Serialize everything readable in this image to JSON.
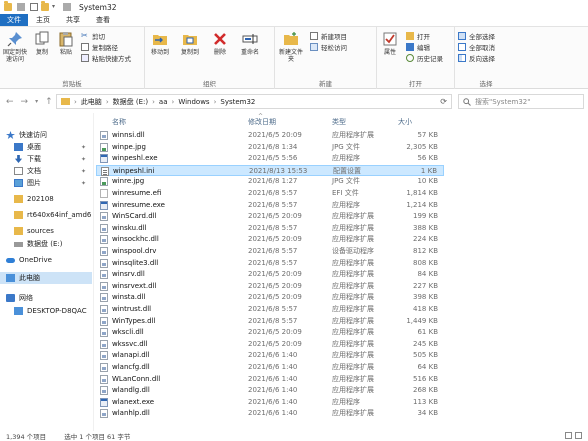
{
  "window": {
    "title": "System32"
  },
  "tabs": [
    "文件",
    "主页",
    "共享",
    "查看"
  ],
  "ribbon": {
    "clipboard": {
      "pin_label": "固定到快速访问",
      "copy_label": "复制",
      "paste_label": "粘贴",
      "cut_label": "剪切",
      "copy_path_label": "复制路径",
      "paste_shortcut_label": "粘贴快捷方式",
      "group_label": "剪贴板"
    },
    "organize": {
      "move_label": "移动到",
      "copy_to_label": "复制到",
      "delete_label": "删除",
      "rename_label": "重命名",
      "group_label": "组织"
    },
    "new": {
      "new_folder_label": "新建文件夹",
      "new_item_label": "新建项目",
      "easy_access_label": "轻松访问",
      "group_label": "新建"
    },
    "open": {
      "properties_label": "属性",
      "open_label": "打开",
      "edit_label": "编辑",
      "history_label": "历史记录",
      "group_label": "打开"
    },
    "select": {
      "select_all_label": "全部选择",
      "select_none_label": "全部取消",
      "invert_label": "反向选择",
      "group_label": "选择"
    }
  },
  "address": {
    "crumbs": [
      "此电脑",
      "数据盘 (E:)",
      "aa",
      "Windows",
      "System32"
    ],
    "search_placeholder": "搜索\"System32\""
  },
  "navpane": [
    {
      "label": "快速访问",
      "icon": "star-icon",
      "pinned": false
    },
    {
      "label": "桌面",
      "icon": "desktop-icon",
      "pinned": true
    },
    {
      "label": "下载",
      "icon": "download-icon",
      "pinned": true
    },
    {
      "label": "文档",
      "icon": "document-icon",
      "pinned": true
    },
    {
      "label": "图片",
      "icon": "picture-icon",
      "pinned": true
    },
    {
      "label": "202108",
      "icon": "folder-icon",
      "pinned": false
    },
    {
      "label": "rt640x64inf_amd6",
      "icon": "folder-icon",
      "pinned": false
    },
    {
      "label": "sources",
      "icon": "folder-icon",
      "pinned": false
    },
    {
      "label": "数据盘 (E:)",
      "icon": "drive-icon",
      "pinned": false
    },
    {
      "label": "OneDrive",
      "icon": "cloud-icon",
      "pinned": false
    },
    {
      "label": "此电脑",
      "icon": "computer-icon",
      "pinned": false
    },
    {
      "label": "网络",
      "icon": "network-icon",
      "pinned": false
    },
    {
      "label": "DESKTOP-D8QAC",
      "icon": "computer-icon",
      "pinned": false
    }
  ],
  "columns": {
    "name": "名称",
    "date": "修改日期",
    "type": "类型",
    "size": "大小"
  },
  "files": [
    {
      "name": "winnsi.dll",
      "date": "2021/6/5 20:09",
      "type": "应用程序扩展",
      "size": "57 KB",
      "kind": "dll"
    },
    {
      "name": "winpe.jpg",
      "date": "2021/6/8 1:34",
      "type": "JPG 文件",
      "size": "2,305 KB",
      "kind": "img"
    },
    {
      "name": "winpeshl.exe",
      "date": "2021/6/5 5:56",
      "type": "应用程序",
      "size": "56 KB",
      "kind": "exe"
    },
    {
      "name": "winpeshl.ini",
      "date": "2021/8/13 15:53",
      "type": "配置设置",
      "size": "1 KB",
      "kind": "ini"
    },
    {
      "name": "winre.jpg",
      "date": "2021/6/8 1:27",
      "type": "JPG 文件",
      "size": "10 KB",
      "kind": "img"
    },
    {
      "name": "winresume.efi",
      "date": "2021/6/8 5:57",
      "type": "EFI 文件",
      "size": "1,814 KB",
      "kind": "efi"
    },
    {
      "name": "winresume.exe",
      "date": "2021/6/8 5:57",
      "type": "应用程序",
      "size": "1,214 KB",
      "kind": "exe"
    },
    {
      "name": "WinSCard.dll",
      "date": "2021/6/5 20:09",
      "type": "应用程序扩展",
      "size": "199 KB",
      "kind": "dll"
    },
    {
      "name": "winsku.dll",
      "date": "2021/6/8 5:57",
      "type": "应用程序扩展",
      "size": "388 KB",
      "kind": "dll"
    },
    {
      "name": "winsockhc.dll",
      "date": "2021/6/5 20:09",
      "type": "应用程序扩展",
      "size": "224 KB",
      "kind": "dll"
    },
    {
      "name": "winspool.drv",
      "date": "2021/6/8 5:57",
      "type": "设备驱动程序",
      "size": "812 KB",
      "kind": "dll"
    },
    {
      "name": "winsqlite3.dll",
      "date": "2021/6/8 5:57",
      "type": "应用程序扩展",
      "size": "808 KB",
      "kind": "dll"
    },
    {
      "name": "winsrv.dll",
      "date": "2021/6/5 20:09",
      "type": "应用程序扩展",
      "size": "84 KB",
      "kind": "dll"
    },
    {
      "name": "winsrvext.dll",
      "date": "2021/6/5 20:09",
      "type": "应用程序扩展",
      "size": "227 KB",
      "kind": "dll"
    },
    {
      "name": "winsta.dll",
      "date": "2021/6/5 20:09",
      "type": "应用程序扩展",
      "size": "398 KB",
      "kind": "dll"
    },
    {
      "name": "wintrust.dll",
      "date": "2021/6/8 5:57",
      "type": "应用程序扩展",
      "size": "418 KB",
      "kind": "dll"
    },
    {
      "name": "WinTypes.dll",
      "date": "2021/6/8 5:57",
      "type": "应用程序扩展",
      "size": "1,449 KB",
      "kind": "dll"
    },
    {
      "name": "wkscli.dll",
      "date": "2021/6/5 20:09",
      "type": "应用程序扩展",
      "size": "61 KB",
      "kind": "dll"
    },
    {
      "name": "wkssvc.dll",
      "date": "2021/6/5 20:09",
      "type": "应用程序扩展",
      "size": "245 KB",
      "kind": "dll"
    },
    {
      "name": "wlanapi.dll",
      "date": "2021/6/6 1:40",
      "type": "应用程序扩展",
      "size": "505 KB",
      "kind": "dll"
    },
    {
      "name": "wlancfg.dll",
      "date": "2021/6/6 1:40",
      "type": "应用程序扩展",
      "size": "64 KB",
      "kind": "dll"
    },
    {
      "name": "WLanConn.dll",
      "date": "2021/6/6 1:40",
      "type": "应用程序扩展",
      "size": "516 KB",
      "kind": "dll"
    },
    {
      "name": "wlandlg.dll",
      "date": "2021/6/6 1:40",
      "type": "应用程序扩展",
      "size": "268 KB",
      "kind": "dll"
    },
    {
      "name": "wlanext.exe",
      "date": "2021/6/6 1:40",
      "type": "应用程序",
      "size": "113 KB",
      "kind": "exe"
    },
    {
      "name": "wlanhlp.dll",
      "date": "2021/6/6 1:40",
      "type": "应用程序扩展",
      "size": "34 KB",
      "kind": "dll"
    }
  ],
  "selected_file": "winpeshl.ini",
  "status": {
    "count": "1,394 个项目",
    "selection": "选中 1 个项目  61 字节"
  }
}
